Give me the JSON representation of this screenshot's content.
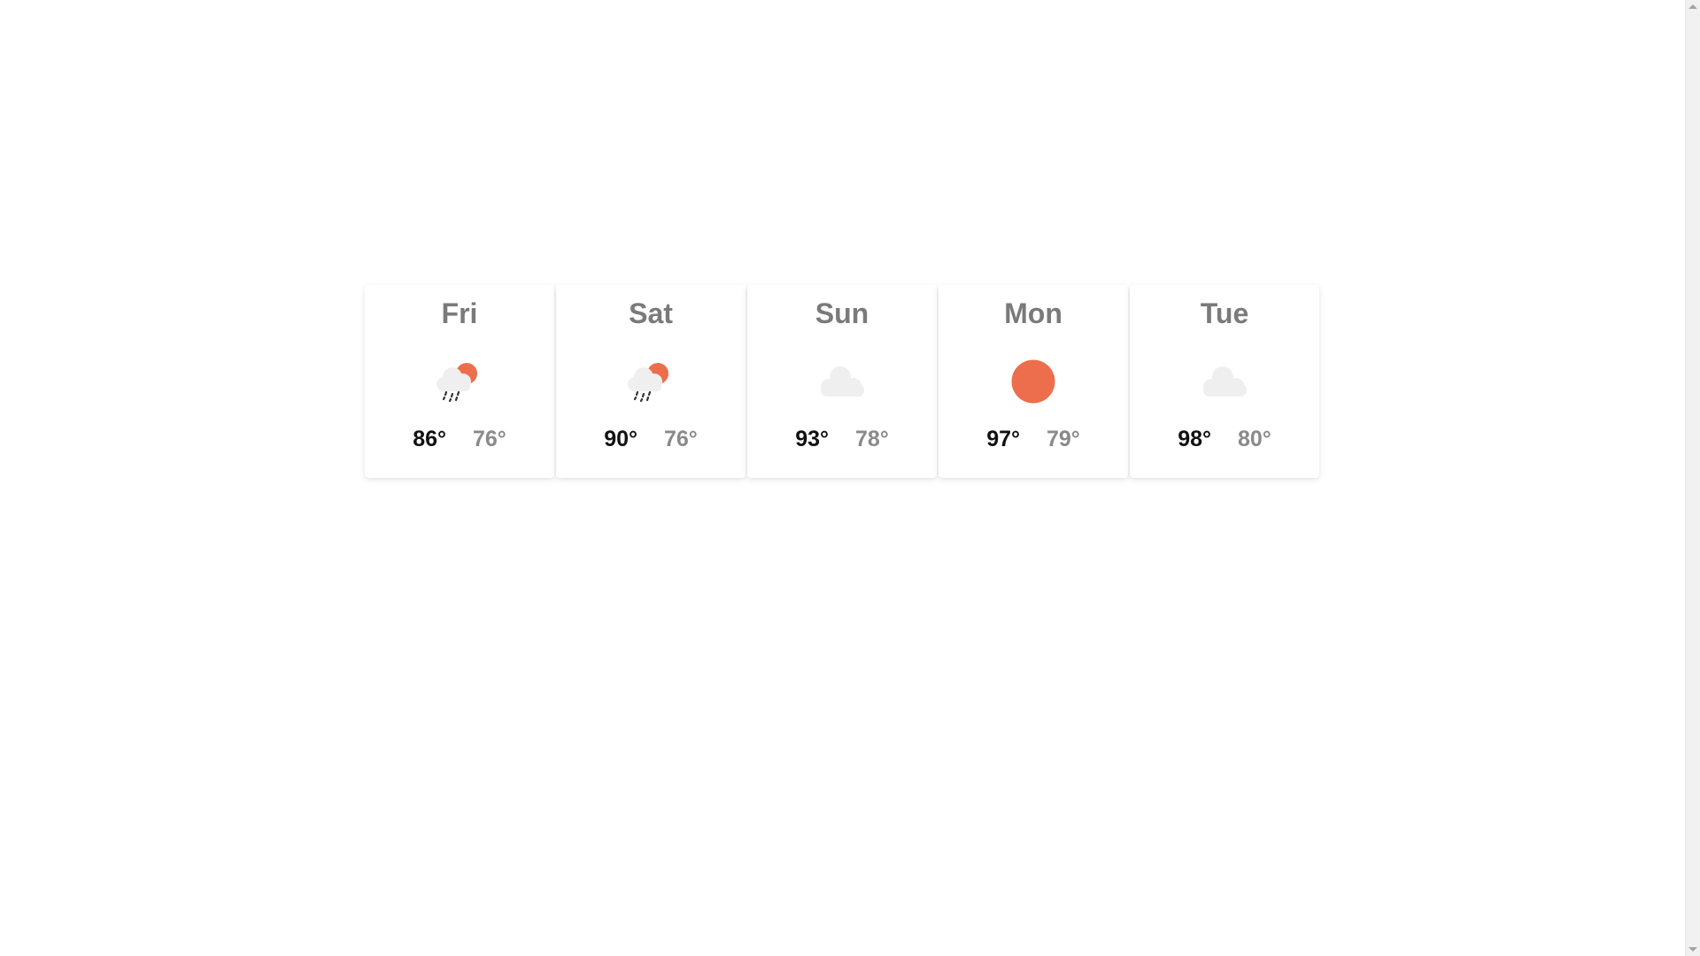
{
  "forecast": [
    {
      "day": "Fri",
      "icon": "rain-sun-icon",
      "high": "86°",
      "low": "76°"
    },
    {
      "day": "Sat",
      "icon": "rain-sun-icon",
      "high": "90°",
      "low": "76°"
    },
    {
      "day": "Sun",
      "icon": "cloud-icon",
      "high": "93°",
      "low": "78°"
    },
    {
      "day": "Mon",
      "icon": "sun-icon",
      "high": "97°",
      "low": "79°"
    },
    {
      "day": "Tue",
      "icon": "cloud-icon",
      "high": "98°",
      "low": "80°"
    }
  ],
  "colors": {
    "sun": "#ec6e4c",
    "cloud": "#efefef",
    "rain": "#333333",
    "day_text": "#7a7a7a",
    "high_text": "#111111",
    "low_text": "#8a8a8a"
  }
}
